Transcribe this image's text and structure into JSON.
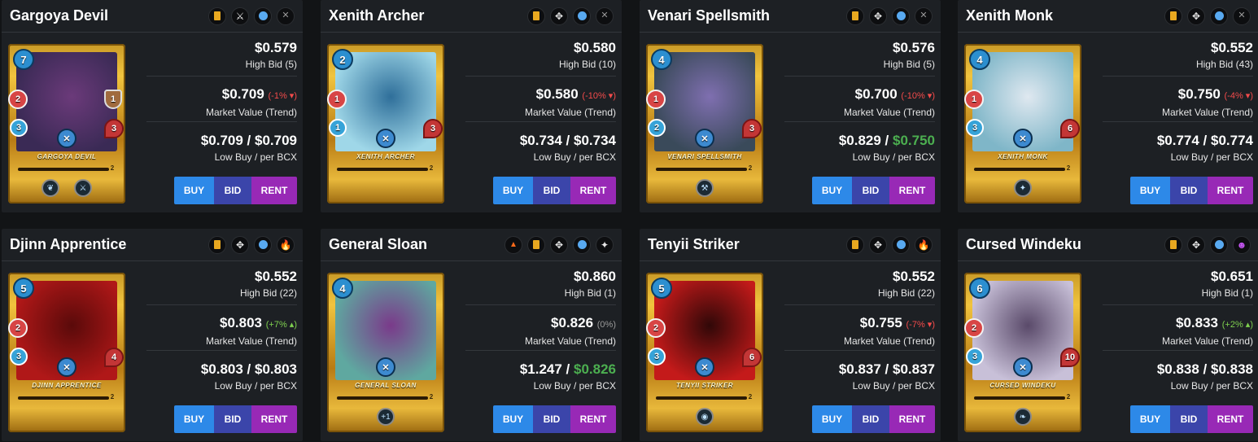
{
  "labels": {
    "high_bid": "High Bid",
    "market_value": "Market Value (Trend)",
    "low_buy": "Low Buy / per BCX",
    "buy": "BUY",
    "bid": "BID",
    "rent": "RENT"
  },
  "colors": {
    "buy": "#2d89e8",
    "bid": "#3b45aa",
    "rent": "#9829b6",
    "trend_down": "#f44b4b",
    "trend_up": "#7fd14f",
    "low_per_bcx_green": "#4caf50"
  },
  "cards": [
    {
      "name": "Gargoya Devil",
      "icons": [
        "gold-foil-icon",
        "melee-icon",
        "rarity-dot-icon",
        "sneak-icon"
      ],
      "art_name": "Gargoya Devil",
      "mana": "7",
      "attack": "2",
      "speed": "3",
      "health": "3",
      "shield": "1",
      "level": "2",
      "abilities": [
        "wing-icon",
        "sword-icon"
      ],
      "price": "$0.579",
      "high_bid_count": "(5)",
      "market_value": "$0.709",
      "trend": "(-1%",
      "trend_dir": "down",
      "low_buy": "$0.709 / ",
      "per_bcx": "$0.709",
      "per_bcx_green": false
    },
    {
      "name": "Xenith Archer",
      "icons": [
        "gold-foil-icon",
        "split-icon",
        "rarity-dot-icon",
        "sneak-icon"
      ],
      "art_name": "Xenith Archer",
      "mana": "2",
      "attack": "1",
      "speed": "1",
      "health": "3",
      "shield": "",
      "level": "2",
      "abilities": [],
      "price": "$0.580",
      "high_bid_count": "(10)",
      "market_value": "$0.580",
      "trend": "(-10%",
      "trend_dir": "down",
      "low_buy": "$0.734 / ",
      "per_bcx": "$0.734",
      "per_bcx_green": false
    },
    {
      "name": "Venari Spellsmith",
      "icons": [
        "gold-foil-icon",
        "split-icon",
        "rarity-dot-icon",
        "sneak-icon"
      ],
      "art_name": "Venari Spellsmith",
      "mana": "4",
      "attack": "1",
      "speed": "2",
      "health": "3",
      "shield": "",
      "level": "2",
      "abilities": [
        "hammer-icon"
      ],
      "price": "$0.576",
      "high_bid_count": "(5)",
      "market_value": "$0.700",
      "trend": "(-10%",
      "trend_dir": "down",
      "low_buy": "$0.829 / ",
      "per_bcx": "$0.750",
      "per_bcx_green": true
    },
    {
      "name": "Xenith Monk",
      "icons": [
        "gold-foil-icon",
        "split-icon",
        "rarity-dot-icon",
        "sneak-icon"
      ],
      "art_name": "Xenith Monk",
      "mana": "4",
      "attack": "1",
      "speed": "3",
      "health": "6",
      "shield": "",
      "level": "2",
      "abilities": [
        "star-icon"
      ],
      "price": "$0.552",
      "high_bid_count": "(43)",
      "market_value": "$0.750",
      "trend": "(-4%",
      "trend_dir": "down",
      "low_buy": "$0.774 / ",
      "per_bcx": "$0.774",
      "per_bcx_green": false
    },
    {
      "name": "Djinn Apprentice",
      "icons": [
        "gold-foil-icon",
        "split-icon",
        "rarity-dot-icon",
        "fire-icon"
      ],
      "art_name": "Djinn Apprentice",
      "mana": "5",
      "attack": "2",
      "speed": "3",
      "health": "4",
      "shield": "",
      "level": "2",
      "abilities": [],
      "price": "$0.552",
      "high_bid_count": "(22)",
      "market_value": "$0.803",
      "trend": "(+7%",
      "trend_dir": "up",
      "low_buy": "$0.803 / ",
      "per_bcx": "$0.803",
      "per_bcx_green": false
    },
    {
      "name": "General Sloan",
      "icons": [
        "triangle-icon",
        "gold-foil-icon",
        "split-icon",
        "rarity-dot-icon",
        "sparkle-icon"
      ],
      "art_name": "General Sloan",
      "mana": "4",
      "attack": "",
      "speed": "",
      "health": "",
      "shield": "",
      "level": "2",
      "abilities": [
        "plus-one-icon"
      ],
      "price": "$0.860",
      "high_bid_count": "(1)",
      "market_value": "$0.826",
      "trend": "(0%)",
      "trend_dir": "flat",
      "low_buy": "$1.247 / ",
      "per_bcx": "$0.826",
      "per_bcx_green": true
    },
    {
      "name": "Tenyii Striker",
      "icons": [
        "gold-foil-icon",
        "split-icon",
        "rarity-dot-icon",
        "fire-icon"
      ],
      "art_name": "Tenyii Striker",
      "mana": "5",
      "attack": "2",
      "speed": "3",
      "health": "6",
      "shield": "",
      "level": "2",
      "abilities": [
        "mask-icon"
      ],
      "price": "$0.552",
      "high_bid_count": "(22)",
      "market_value": "$0.755",
      "trend": "(-7%",
      "trend_dir": "down",
      "low_buy": "$0.837 / ",
      "per_bcx": "$0.837",
      "per_bcx_green": false
    },
    {
      "name": "Cursed Windeku",
      "icons": [
        "gold-foil-icon",
        "split-icon",
        "rarity-dot-icon",
        "death-icon"
      ],
      "art_name": "Cursed Windeku",
      "mana": "6",
      "attack": "2",
      "speed": "3",
      "health": "10",
      "shield": "",
      "level": "2",
      "abilities": [
        "scorpion-icon"
      ],
      "price": "$0.651",
      "high_bid_count": "(1)",
      "market_value": "$0.833",
      "trend": "(+2%",
      "trend_dir": "up",
      "low_buy": "$0.838 / ",
      "per_bcx": "$0.838",
      "per_bcx_green": false
    }
  ]
}
